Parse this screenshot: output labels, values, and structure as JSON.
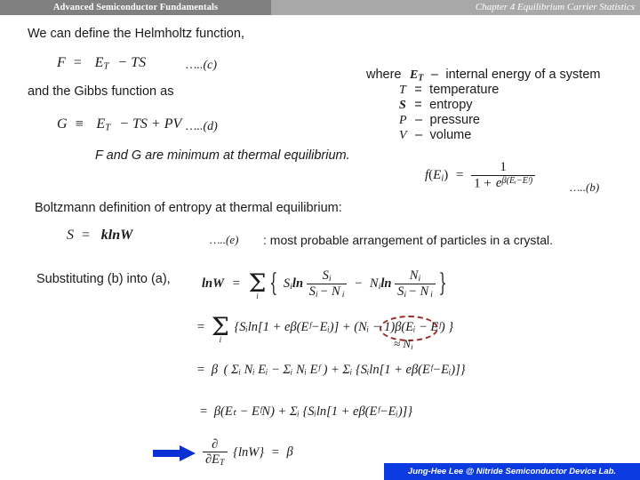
{
  "header": {
    "title": "Advanced Semiconductor Fundamentals",
    "chapter": "Chapter 4  Equilibrium Carrier Statistics",
    "left_band_color": "#808080",
    "right_band_color": "#a8a8a8",
    "text_color": "#ffffff"
  },
  "body": {
    "line_helmholtz": "We can define the Helmholtz function,",
    "line_gibbs": "and the Gibbs function as",
    "line_minimum": "F and G are minimum at thermal equilibrium.",
    "line_boltzmann": "Boltzmann definition of entropy at thermal equilibrium:",
    "line_arrangement": ": most probable arrangement of particles in a crystal.",
    "line_substituting": "Substituting (b) into (a),"
  },
  "equations": {
    "helmholtz": {
      "lhs": "F",
      "rel": "=",
      "rhs_E": "E",
      "rhs_E_sub": "T",
      "rhs_rest": "− TS",
      "tag": "…..(c)"
    },
    "gibbs": {
      "lhs": "G",
      "rel": "≡",
      "rhs_E": "E",
      "rhs_E_sub": "T",
      "rhs_rest": "− TS + PV",
      "tag": "…..(d)"
    },
    "fermi": {
      "lhs_f": "f",
      "lhs_arg_open": "(",
      "lhs_E": "E",
      "lhs_E_sub": "i",
      "lhs_arg_close": ")",
      "rel": "=",
      "numerator": "1",
      "den_lead": "1 +",
      "den_e": "e",
      "den_exp": "β(Eᵢ−Eᶠ)",
      "tag": "…..(b)"
    },
    "entropy": {
      "lhs": "S",
      "rel": "=",
      "rhs": "klnW",
      "tag": "…..(e)"
    },
    "derivation": {
      "line1": {
        "lhs": "lnW",
        "rel": "=",
        "sigma_index": "i",
        "brace_open": "{",
        "term1_lead": "S",
        "term1_lead_sub": "i",
        "term1_ln": "ln",
        "frac1_num": "S",
        "frac1_num_sub": "i",
        "frac1_den": "S",
        "frac1_den_sub": "i",
        "frac1_den_rest": "−  N",
        "frac1_den_rest_sub": "i",
        "minus": "−",
        "term2_lead": "N",
        "term2_lead_sub": "i",
        "term2_ln": "ln",
        "frac2_num": "N",
        "frac2_num_sub": "i",
        "frac2_den": "S",
        "frac2_den_sub": "i",
        "frac2_den_rest": "−  N",
        "frac2_den_rest_sub": "i",
        "brace_close": "}"
      },
      "line2": {
        "rel": "=",
        "sigma_index": "i",
        "text": "{Sᵢln[1 +  eβ(Eᶠ−Eᵢ)] + (Nᵢ − 1)β(Eᵢ − Eᶠ) }",
        "approx_note": "≈ N",
        "approx_note_sub": "i",
        "annotation_color": "#9c2b2b",
        "annotation_target": "(Nᵢ − 1)"
      },
      "line3": {
        "rel": "=",
        "beta": "β",
        "text": "( Σᵢ Nᵢ Eᵢ − Σᵢ Nᵢ Eᶠ ) + Σᵢ {Sᵢln[1 +  eβ(Eᶠ−Eᵢ)]}"
      },
      "line4": {
        "rel": "=",
        "text": "β(Eₜ − EᶠN) + Σᵢ {Sᵢln[1 +  eβ(Eᶠ−Eᵢ)]}"
      },
      "line5": {
        "arrow_color": "#0a2fd4",
        "partial_num": "∂",
        "partial_den": "∂E",
        "partial_den_sub": "T",
        "body": "{lnW}",
        "rel": "=",
        "rhs": "β"
      }
    }
  },
  "definitions": {
    "intro": "where",
    "items": [
      {
        "symbol": "E",
        "symbol_sub": "T",
        "sep": "–",
        "text": "internal energy of a system"
      },
      {
        "symbol": "T",
        "symbol_sub": "",
        "sep": "=",
        "text": "temperature"
      },
      {
        "symbol": "S",
        "symbol_sub": "",
        "sep": "=",
        "text": "entropy"
      },
      {
        "symbol": "P",
        "symbol_sub": "",
        "sep": "–",
        "text": "pressure"
      },
      {
        "symbol": "V",
        "symbol_sub": "",
        "sep": "–",
        "text": "volume"
      }
    ]
  },
  "footer": {
    "text": "Jung-Hee Lee @ Nitride Semiconductor Device Lab.",
    "bar_color": "#0a3ae0",
    "text_color": "#ffffff"
  }
}
